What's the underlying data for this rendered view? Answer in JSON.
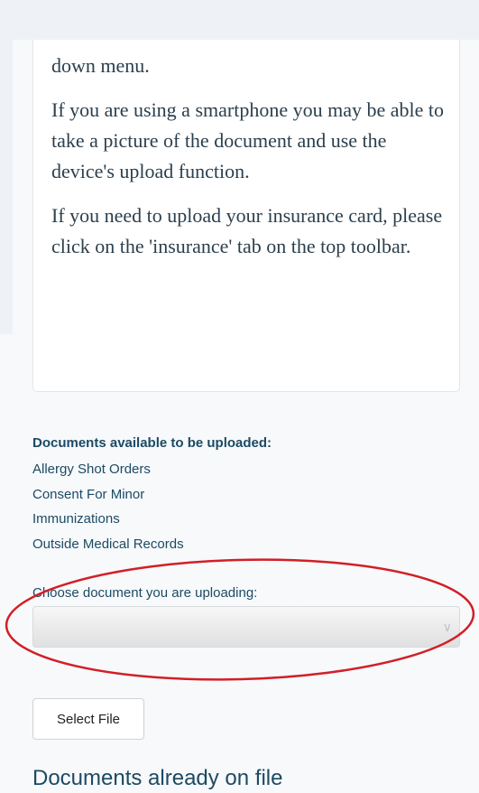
{
  "instructions": {
    "paragraphs": [
      "down menu.",
      "If you are using a smartphone you may be able to take a picture of the document and use the device's upload function.",
      "If you need to upload your insurance card, please click on the 'insurance' tab on the top toolbar."
    ]
  },
  "documents_available": {
    "heading": "Documents available to be uploaded:",
    "items": [
      "Allergy Shot Orders",
      "Consent For Minor",
      "Immunizations",
      "Outside Medical Records"
    ]
  },
  "upload_form": {
    "choose_label": "Choose document you are uploading:",
    "selected_value": "",
    "select_file_label": "Select File"
  },
  "documents_on_file": {
    "heading": "Documents already on file"
  },
  "annotation": {
    "color": "#d21f26"
  }
}
